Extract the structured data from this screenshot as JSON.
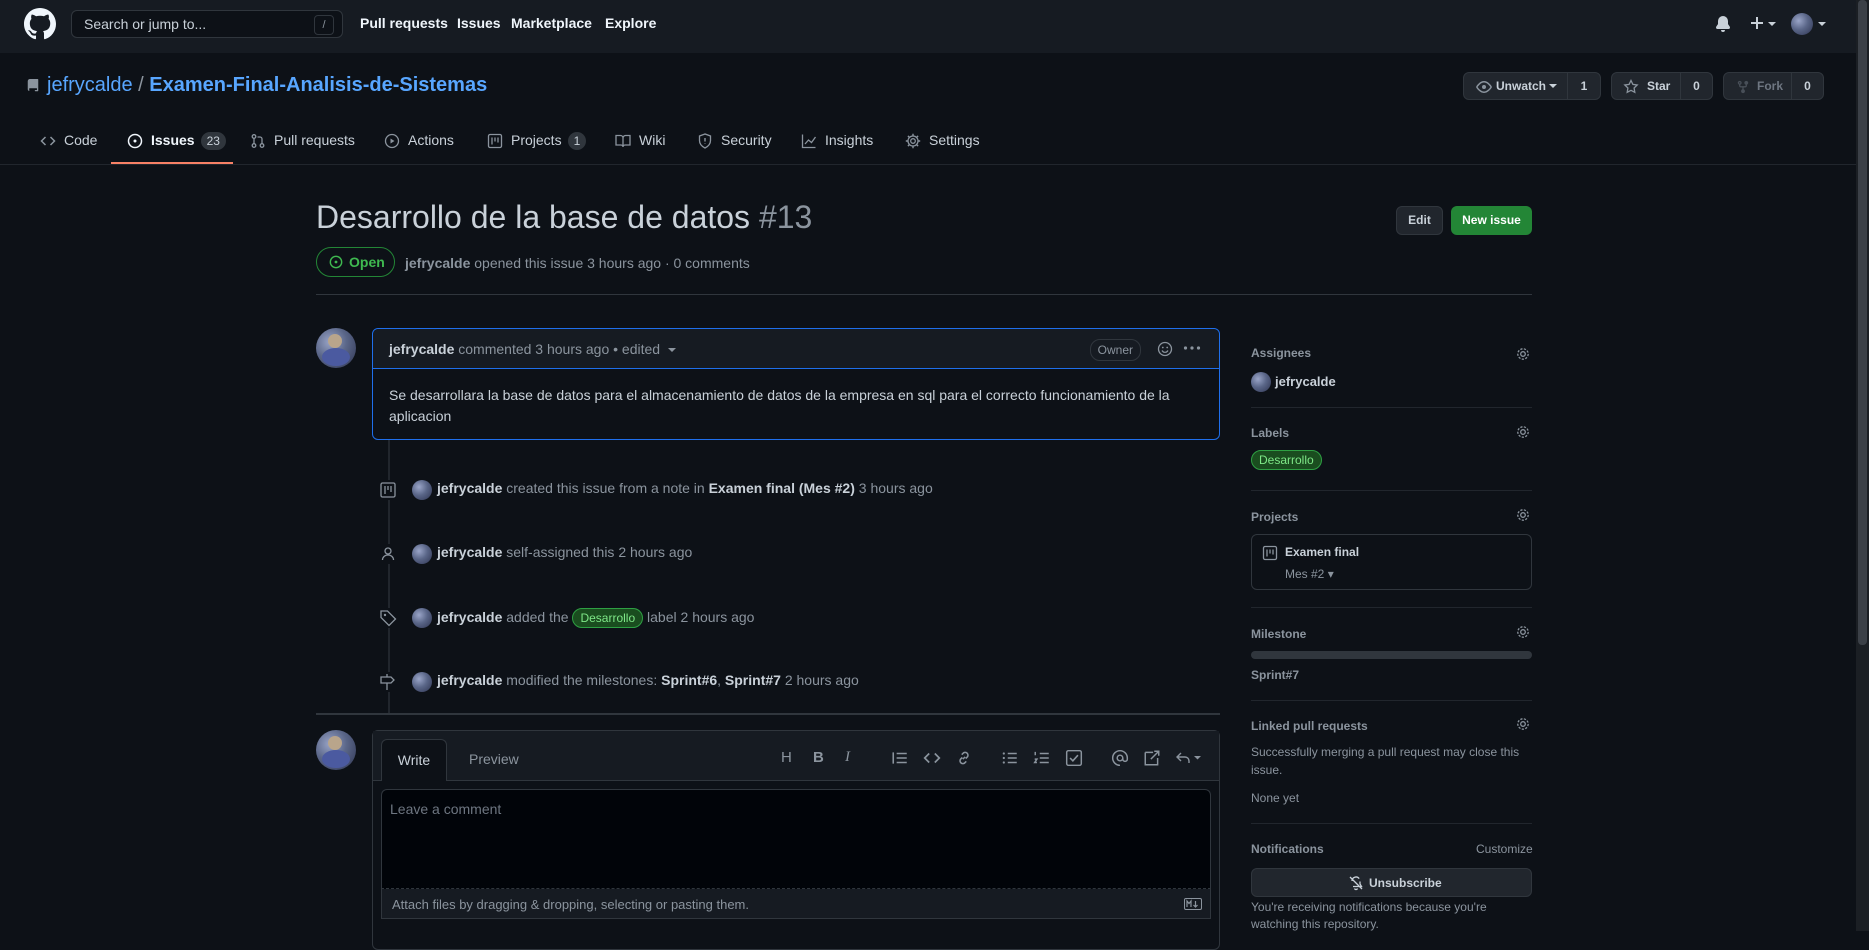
{
  "header": {
    "search_placeholder": "Search or jump to...",
    "search_shortcut": "/",
    "nav": [
      "Pull requests",
      "Issues",
      "Marketplace",
      "Explore"
    ]
  },
  "repo": {
    "owner": "jefrycalde",
    "separator": "/",
    "name": "Examen-Final-Analisis-de-Sistemas",
    "watch_label": "Unwatch",
    "watch_count": "1",
    "star_label": "Star",
    "star_count": "0",
    "fork_label": "Fork",
    "fork_count": "0"
  },
  "tabs": [
    {
      "label": "Code"
    },
    {
      "label": "Issues",
      "count": "23"
    },
    {
      "label": "Pull requests"
    },
    {
      "label": "Actions"
    },
    {
      "label": "Projects",
      "count": "1"
    },
    {
      "label": "Wiki"
    },
    {
      "label": "Security"
    },
    {
      "label": "Insights"
    },
    {
      "label": "Settings"
    }
  ],
  "issue": {
    "title": "Desarrollo de la base de datos",
    "number": "#13",
    "state": "Open",
    "author": "jefrycalde",
    "meta_rest": "opened this issue 3 hours ago · 0 comments",
    "edit_label": "Edit",
    "new_issue_label": "New issue"
  },
  "comment": {
    "author": "jefrycalde",
    "meta": "commented 3 hours ago • edited",
    "role": "Owner",
    "body": "Se desarrollara la base de datos para el almacenamiento de datos de la empresa en sql para el correcto funcionamiento de la aplicacion"
  },
  "timeline": {
    "e1": {
      "actor": "jefrycalde",
      "text": "created this issue from a note in",
      "project": "Examen final",
      "column": "(Mes #2)",
      "time": "3 hours ago"
    },
    "e2": {
      "actor": "jefrycalde",
      "text": "self-assigned this",
      "time": "2 hours ago"
    },
    "e3": {
      "actor": "jefrycalde",
      "text": "added the",
      "label": "Desarrollo",
      "text2": "label",
      "time": "2 hours ago"
    },
    "e4": {
      "actor": "jefrycalde",
      "text": "modified the milestones:",
      "m1": "Sprint#6",
      "comma": ",",
      "m2": "Sprint#7",
      "time": "2 hours ago"
    }
  },
  "editor": {
    "tab_write": "Write",
    "tab_preview": "Preview",
    "placeholder": "Leave a comment",
    "attach": "Attach files by dragging & dropping, selecting or pasting them.",
    "toolbar_heading": "H",
    "toolbar_bold": "B",
    "toolbar_italic": "I"
  },
  "sidebar": {
    "assignees_title": "Assignees",
    "assignee": "jefrycalde",
    "labels_title": "Labels",
    "label": "Desarrollo",
    "projects_title": "Projects",
    "project_name": "Examen final",
    "project_column": "Mes #2",
    "milestone_title": "Milestone",
    "milestone_progress": 0,
    "milestone_name": "Sprint#7",
    "linked_title": "Linked pull requests",
    "linked_desc_1": "Successfully merging a pull request may close this",
    "linked_desc_2": "issue.",
    "linked_none": "None yet",
    "notifications_title": "Notifications",
    "customize": "Customize",
    "unsubscribe": "Unsubscribe",
    "notif_desc_1": "You're receiving notifications because you're",
    "notif_desc_2": "watching this repository."
  },
  "colors": {
    "bg": "#0d1117",
    "header_bg": "#161b22",
    "link": "#58a6ff",
    "green": "#238636",
    "open": "#3fb950",
    "accent_underline": "#f78166"
  }
}
